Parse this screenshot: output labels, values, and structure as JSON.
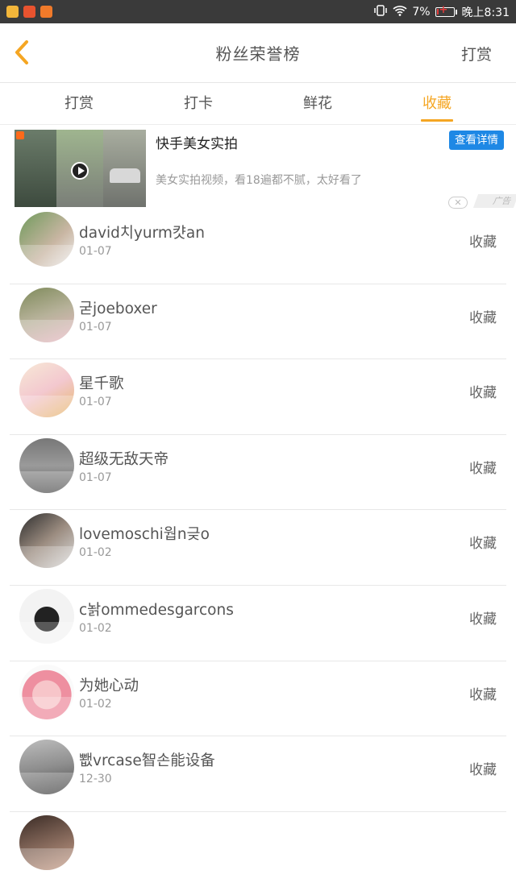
{
  "status_bar": {
    "battery_percent": "7%",
    "time": "晚上8:31",
    "battery_level": 0.07,
    "icons": [
      "app-icon-1",
      "app-icon-2",
      "app-icon-3",
      "vibrate-icon",
      "wifi-icon",
      "battery-icon"
    ]
  },
  "header": {
    "title": "粉丝荣誉榜",
    "right_action": "打赏",
    "back_icon": "chevron-left-icon"
  },
  "tabs": [
    {
      "label": "打赏"
    },
    {
      "label": "打卡"
    },
    {
      "label": "鲜花"
    },
    {
      "label": "收藏"
    }
  ],
  "active_tab": "收藏",
  "ad": {
    "title": "快手美女实拍",
    "description": "美女实拍视频，看18遍都不腻，太好看了",
    "button": "查看详情",
    "close": "✕",
    "label": "广告"
  },
  "list": [
    {
      "name": "david치yurm캿an",
      "date": "01-07",
      "action": "收藏"
    },
    {
      "name": "굳joeboxer",
      "date": "01-07",
      "action": "收藏"
    },
    {
      "name": "星千歌",
      "date": "01-07",
      "action": "收藏"
    },
    {
      "name": "超级无敌天帝",
      "date": "01-07",
      "action": "收藏"
    },
    {
      "name": "lovemoschi웝n긎o",
      "date": "01-02",
      "action": "收藏"
    },
    {
      "name": "c놝ommedesgarcons",
      "date": "01-02",
      "action": "收藏"
    },
    {
      "name": "为她心动",
      "date": "01-02",
      "action": "收藏"
    },
    {
      "name": "뾊vrcase智손能设备",
      "date": "12-30",
      "action": "收藏"
    }
  ],
  "colors": {
    "accent": "#f5a623",
    "ad_button": "#1e88e5",
    "status_bar": "#3a3a3a"
  }
}
